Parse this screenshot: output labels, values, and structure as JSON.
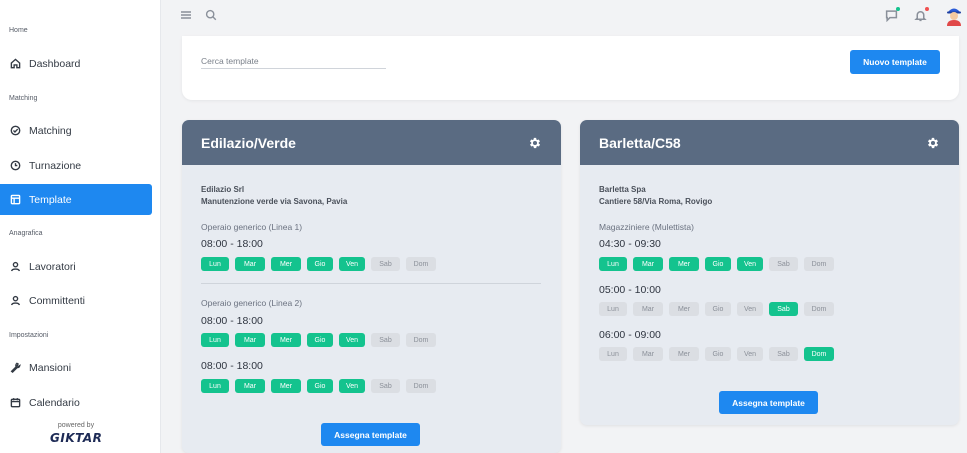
{
  "sidebar": {
    "sections": {
      "home": "Home",
      "matching": "Matching",
      "anagrafica": "Anagrafica",
      "impostazioni": "Impostazioni"
    },
    "items": {
      "dashboard": "Dashboard",
      "matching": "Matching",
      "turnazione": "Turnazione",
      "template": "Template",
      "lavoratori": "Lavoratori",
      "committenti": "Committenti",
      "mansioni": "Mansioni",
      "calendario": "Calendario"
    },
    "powered_by": "powered by",
    "logo": "GIKTAR"
  },
  "search": {
    "placeholder": "Cerca template",
    "new_button": "Nuovo template"
  },
  "colors": {
    "accent": "#1e88f0",
    "day_on": "#14c38e",
    "day_off": "#dbdee3",
    "card_header": "#5a6b82"
  },
  "days": [
    "Lun",
    "Mar",
    "Mer",
    "Gio",
    "Ven",
    "Sab",
    "Dom"
  ],
  "cards": [
    {
      "title": "Edilazio/Verde",
      "company": "Edilazio Srl",
      "site": "Manutenzione verde via Savona, Pavia",
      "assign": "Assegna template",
      "roles": [
        {
          "name": "Operaio generico (Linea 1)",
          "times": [
            "08:00 - 18:00"
          ]
        },
        {
          "name": "Operaio generico (Linea 2)",
          "times": [
            "08:00 - 18:00",
            "08:00 - 18:00"
          ]
        }
      ]
    },
    {
      "title": "Barletta/C58",
      "company": "Barletta Spa",
      "site": "Cantiere 58/Via Roma, Rovigo",
      "assign": "Assegna template",
      "roles": [
        {
          "name": "Magazziniere (Mulettista)",
          "times": [
            "04:30 - 09:30",
            "05:00 - 10:00",
            "06:00 - 09:00"
          ]
        }
      ]
    }
  ]
}
